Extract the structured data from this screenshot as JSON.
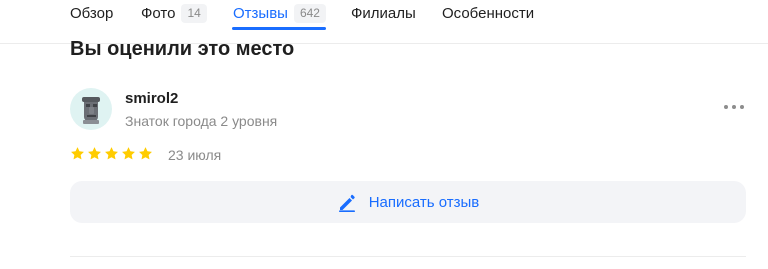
{
  "tabs": [
    {
      "label": "Обзор",
      "count": ""
    },
    {
      "label": "Фото",
      "count": "14"
    },
    {
      "label": "Отзывы",
      "count": "642"
    },
    {
      "label": "Филиалы",
      "count": ""
    },
    {
      "label": "Особенности",
      "count": ""
    }
  ],
  "active_tab": "Отзывы",
  "section_title": "Вы оценили это место",
  "review": {
    "author": "smirol2",
    "level": "Знаток города 2 уровня",
    "rating": 5,
    "max_rating": 5,
    "date": "23 июля"
  },
  "write_review_label": "Написать отзыв",
  "colors": {
    "accent": "#196dff",
    "star": "#ffcc00"
  },
  "icons": {
    "more": "more-dots-icon",
    "write": "pen-icon",
    "star": "star-icon",
    "avatar": "moai-avatar-icon"
  }
}
